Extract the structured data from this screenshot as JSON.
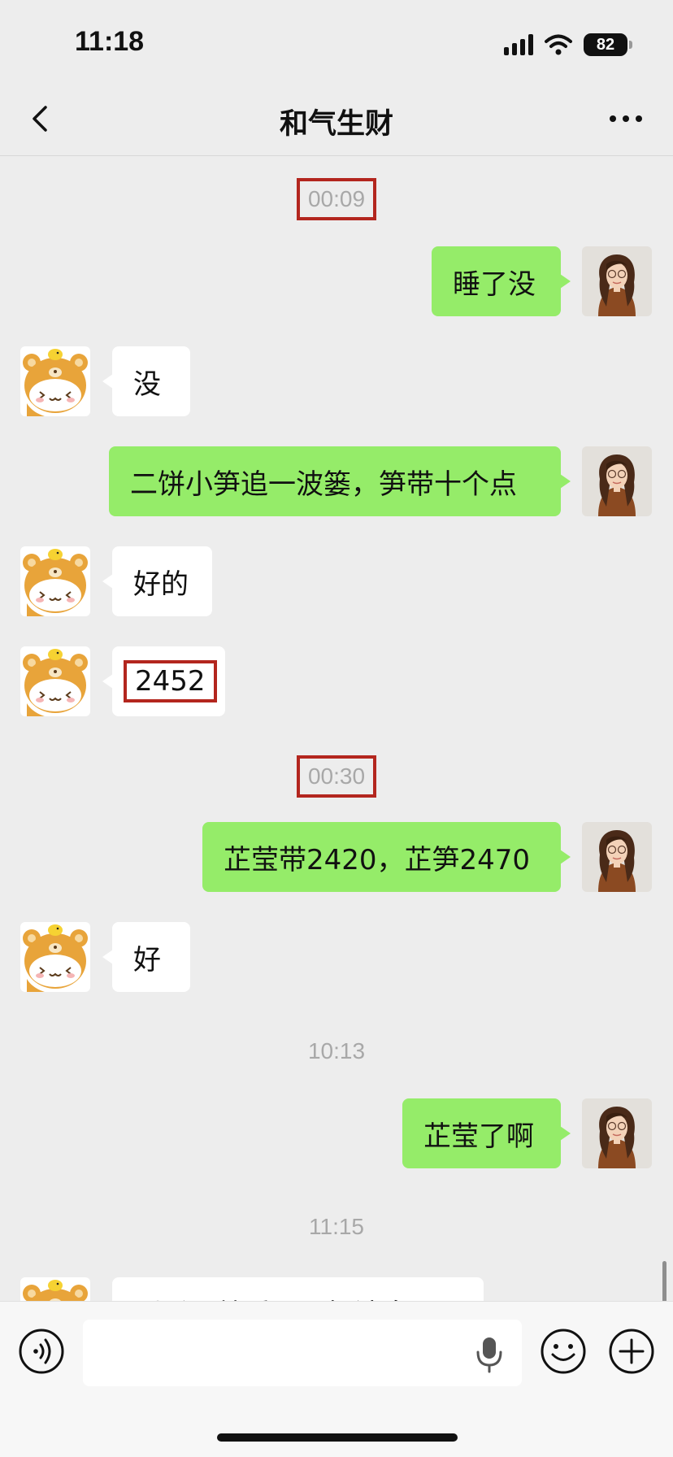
{
  "status": {
    "time": "11:18",
    "battery": "82"
  },
  "header": {
    "title": "和气生财",
    "back_icon": "chevron-left-icon",
    "more_icon": "more-dots-icon"
  },
  "messages": {
    "ts1": "00:09",
    "m1": "睡了没",
    "m2": "没",
    "m3": "二饼小笋追一波篓，笋带十个点",
    "m4": "好的",
    "m5": "2452",
    "ts2": "00:30",
    "m6": "芷莹带2420，芷笋2470",
    "m7": "好",
    "ts3": "10:13",
    "m8": "芷莹了啊",
    "ts4": "11:15",
    "m9": "刚睡醒就看见了好消息"
  },
  "input": {
    "value": "",
    "placeholder": ""
  },
  "colors": {
    "sent_bubble": "#95ec69",
    "received_bubble": "#ffffff",
    "background": "#ededed",
    "highlight_box": "#b3261e"
  }
}
